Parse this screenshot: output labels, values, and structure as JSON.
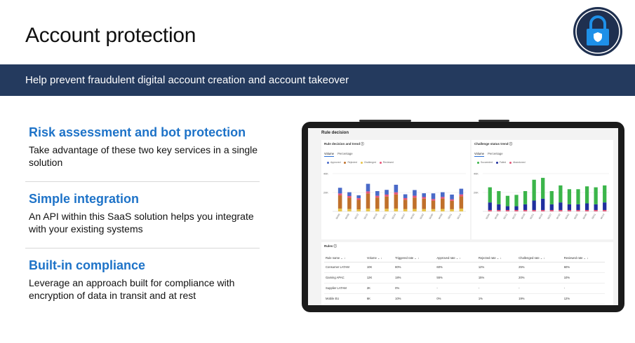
{
  "header": {
    "title": "Account protection"
  },
  "banner": {
    "text": "Help prevent fraudulent digital account creation and account takeover"
  },
  "badge": {
    "icon": "lock-icon",
    "bg_color": "#1f3050",
    "lock_color": "#1e90e8"
  },
  "features": [
    {
      "title": "Risk assessment and bot protection",
      "text": "Take advantage of these two key services in a single solution"
    },
    {
      "title": "Simple integration",
      "text": "An API within this SaaS solution helps you integrate with your existing systems"
    },
    {
      "title": "Built-in compliance",
      "text": "Leverage an approach built for compliance with encryption of data in transit and at rest"
    }
  ],
  "screen": {
    "title": "Rule decision",
    "rule_card": {
      "title": "Rule decision and trend",
      "tabs": [
        "Volume",
        "Percentage"
      ],
      "legend": [
        "Approved",
        "Rejected",
        "Challenged",
        "Reviewed"
      ]
    },
    "challenge_card": {
      "title": "Challenge status trend",
      "tabs": [
        "Volume",
        "Percentage"
      ],
      "legend": [
        "Succeeded",
        "Failed",
        "Abandoned"
      ]
    },
    "rules_table": {
      "title": "Rules",
      "columns": [
        "Rule name",
        "Volume",
        "Triggered rate",
        "Approved rate",
        "Rejected rate",
        "Challenged rate",
        "Reviewed rate"
      ],
      "rows": [
        [
          "Consumer LATAM",
          "10K",
          "80%",
          "60%",
          "12%",
          "25%",
          "60%"
        ],
        [
          "Gaming APAC",
          "12K",
          "18%",
          "55%",
          "15%",
          "20%",
          "10%"
        ],
        [
          "Supplier LATAM",
          "2K",
          "0%",
          "-",
          "-",
          "-",
          "-"
        ],
        [
          "Mobile EU",
          "6K",
          "10%",
          "0%",
          "1%",
          "19%",
          "12%"
        ]
      ]
    }
  },
  "chart_data": [
    {
      "type": "bar",
      "title": "Rule decision and trend",
      "stacked": true,
      "categories": [
        "05/06",
        "05/09",
        "05/12",
        "05/15",
        "05/18",
        "05/21",
        "05/24",
        "05/27",
        "05/30",
        "06/02",
        "06/05",
        "06/08",
        "06/11",
        "06/14"
      ],
      "ylim": [
        0,
        40000
      ],
      "yticks": [
        "40K",
        "20K"
      ],
      "series": [
        {
          "name": "Approved",
          "color": "#e8c44a",
          "values": [
            3000,
            2500,
            2200,
            3000,
            2700,
            2800,
            3000,
            2400,
            2600,
            2500,
            2400,
            2600,
            2300,
            3000
          ]
        },
        {
          "name": "Rejected",
          "color": "#c0702b",
          "values": [
            14000,
            12000,
            10000,
            16000,
            12000,
            13000,
            15000,
            10000,
            12000,
            11000,
            9000,
            11000,
            9000,
            13000
          ]
        },
        {
          "name": "Challenged",
          "color": "#e8557a",
          "values": [
            2000,
            1800,
            1800,
            2200,
            1800,
            2000,
            2200,
            1700,
            2000,
            1700,
            1700,
            1700,
            1500,
            2000
          ]
        },
        {
          "name": "Reviewed",
          "color": "#4a6ac8",
          "values": [
            6000,
            4000,
            3000,
            8000,
            5000,
            5000,
            8000,
            4000,
            6000,
            4000,
            6000,
            5000,
            5000,
            6000
          ]
        }
      ]
    },
    {
      "type": "bar",
      "title": "Challenge status trend",
      "stacked": true,
      "categories": [
        "05/06",
        "05/09",
        "05/12",
        "05/15",
        "05/18",
        "05/21",
        "05/24",
        "05/27",
        "05/30",
        "06/02",
        "06/05",
        "06/08",
        "06/11",
        "06/14"
      ],
      "ylim": [
        0,
        40000
      ],
      "yticks": [
        "40K",
        "20K"
      ],
      "series": [
        {
          "name": "Abandoned",
          "color": "#e05a7a",
          "values": [
            1500,
            1500,
            1500,
            1500,
            1500,
            1500,
            1500,
            1500,
            1500,
            1500,
            1500,
            1500,
            1500,
            1500
          ]
        },
        {
          "name": "Failed",
          "color": "#1f2f9e",
          "values": [
            8000,
            6000,
            4000,
            4000,
            6000,
            10000,
            12000,
            6000,
            8000,
            6000,
            6000,
            7000,
            6000,
            8000
          ]
        },
        {
          "name": "Succeeded",
          "color": "#3bb54a",
          "values": [
            16000,
            14000,
            11000,
            12000,
            14000,
            22000,
            22000,
            14000,
            18000,
            16000,
            16000,
            18000,
            18000,
            18000
          ]
        }
      ]
    }
  ]
}
